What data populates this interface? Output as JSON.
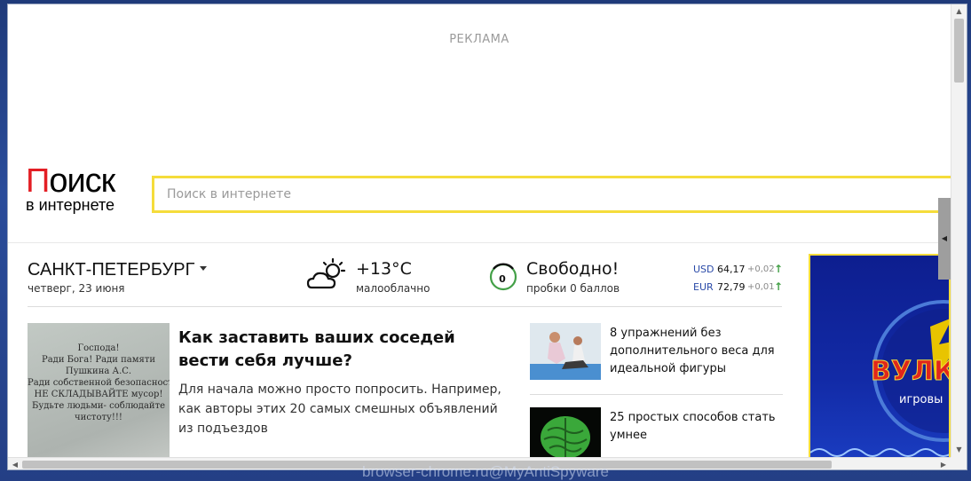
{
  "ad_top": {
    "label": "РЕКЛАМА"
  },
  "logo": {
    "first_letter": "П",
    "rest": "оиск",
    "subtitle": "в интернете"
  },
  "search": {
    "placeholder": "Поиск в интернете",
    "value": ""
  },
  "city": {
    "name": "САНКТ-ПЕТЕРБУРГ",
    "date": "четверг, 23 июня"
  },
  "weather": {
    "temperature": "+13°C",
    "description": "малооблачно",
    "icon": "partly-cloudy-icon"
  },
  "traffic": {
    "status": "Свободно!",
    "subtitle": "пробки 0 баллов",
    "score": "0",
    "score_color": "#43a047",
    "icon": "traffic-gauge-icon"
  },
  "currency": [
    {
      "code": "USD",
      "value": "64,17",
      "delta": "+0,02",
      "trend_icon": "arrow-up-icon"
    },
    {
      "code": "EUR",
      "value": "72,79",
      "delta": "+0,01",
      "trend_icon": "arrow-up-icon"
    }
  ],
  "news_main": {
    "title": "Как заставить ваших соседей вести себя лучше?",
    "text": "Для начала можно просто попросить. Например, как авторы этих 20 самых смешных объявлений из подъездов",
    "image_text": [
      "Господа!",
      "Ради Бога! Ради памяти",
      "Пушкина А.С.",
      "Ради собственной безопасности",
      "НЕ СКЛАДЫВАЙТЕ мусор!",
      "Будьте людьми- соблюдайте",
      "чистоту!!!"
    ]
  },
  "news_side": [
    {
      "title": "8 упражнений без дополнительного веса для идеальной фигуры"
    },
    {
      "title": "25 простых способов стать умнее"
    }
  ],
  "ad_right": {
    "brand_fragment": "ВУЛК",
    "tagline_fragment": "игровы"
  },
  "watermark": "browser-chrome.ru@MyAntiSpyware",
  "colors": {
    "search_border": "#f5dc3b",
    "logo_accent": "#e31e24",
    "currency_code": "#2a4aa8",
    "trend_up": "#43a047"
  }
}
